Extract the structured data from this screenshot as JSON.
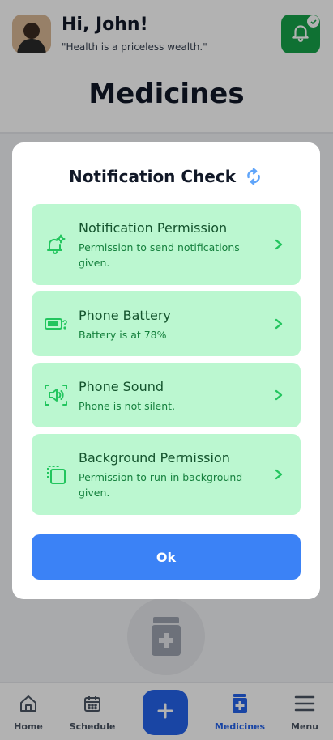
{
  "header": {
    "greeting": "Hi, John!",
    "quote": "\"Health is a priceless wealth.\"",
    "page_title": "Medicines",
    "avatar_icon": "user-avatar",
    "bell_icon": "bell-icon",
    "bell_status_icon": "check-icon"
  },
  "colors": {
    "brand_green": "#16a34a",
    "card_bg": "#bbf7d0",
    "card_text": "#15803d",
    "accent_blue": "#3b82f6",
    "nav_active": "#2563eb"
  },
  "modal": {
    "title": "Notification Check",
    "refresh_icon": "refresh-icon",
    "checks": [
      {
        "icon": "bell-gear-icon",
        "title": "Notification Permission",
        "description": "Permission to send notifications given."
      },
      {
        "icon": "battery-icon",
        "title": "Phone Battery",
        "description": "Battery is at 78%"
      },
      {
        "icon": "volume-icon",
        "title": "Phone Sound",
        "description": "Phone is not silent."
      },
      {
        "icon": "background-layers-icon",
        "title": "Background Permission",
        "description": "Permission to run in background given."
      }
    ],
    "ok_label": "Ok"
  },
  "nav": {
    "items": [
      {
        "label": "Home",
        "icon": "home-icon",
        "active": false
      },
      {
        "label": "Schedule",
        "icon": "calendar-icon",
        "active": false
      },
      {
        "label": "",
        "icon": "plus-icon",
        "active": false
      },
      {
        "label": "Medicines",
        "icon": "medicine-icon",
        "active": true
      },
      {
        "label": "Menu",
        "icon": "menu-icon",
        "active": false
      }
    ]
  }
}
